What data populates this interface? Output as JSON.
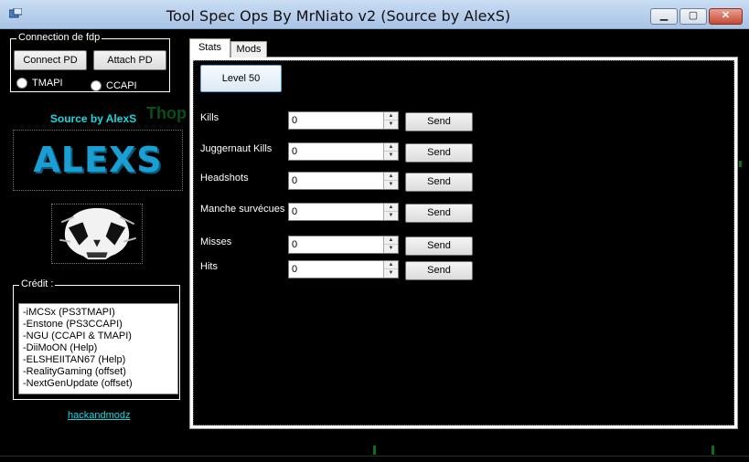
{
  "window": {
    "title": "Tool Spec Ops By MrNiato v2 (Source by AlexS)",
    "minimize_label": "▁",
    "maximize_label": "▢",
    "close_label": "✕"
  },
  "connection": {
    "group_label": "Connection de fdp",
    "connect_label": "Connect PD",
    "attach_label": "Attach PD",
    "radio_tmapi": "TMAPI",
    "radio_ccapi": "CCAPI"
  },
  "source": {
    "title": "Source by AlexS",
    "ghost_text": "Thop",
    "logo_text": "ALEXS"
  },
  "credits": {
    "group_label": "Crédit :",
    "items": [
      "-iMCSx (PS3TMAPI)",
      "-Enstone (PS3CCAPI)",
      "-NGU (CCAPI & TMAPI)",
      "-DiiMoON (Help)",
      "-ELSHEIITAN67 (Help)",
      "-RealityGaming (offset)",
      "-NextGenUpdate (offset)"
    ]
  },
  "link_text": "hackandmodz",
  "tabs": {
    "stats": "Stats",
    "mods": "Mods"
  },
  "stats": {
    "level_button": "Level 50",
    "send_label": "Send",
    "rows": [
      {
        "label": "Kills",
        "value": "0"
      },
      {
        "label": "Juggernaut Kills",
        "value": "0"
      },
      {
        "label": "Headshots",
        "value": "0"
      },
      {
        "label": "Manche survécues",
        "value": "0"
      },
      {
        "label": "Misses",
        "value": "0"
      },
      {
        "label": "Hits",
        "value": "0"
      }
    ]
  },
  "colors": {
    "accent_cyan": "#19d7e0",
    "logo_blue": "#1a9fd4",
    "background": "#000000"
  }
}
